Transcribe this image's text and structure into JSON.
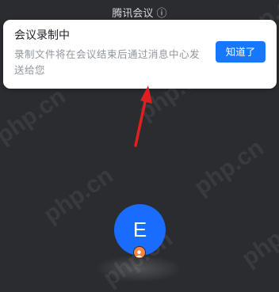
{
  "meeting": {
    "title": "腾讯会议 ⓘ"
  },
  "toast": {
    "title": "会议录制中",
    "message": "录制文件将在会议结束后通过消息中心发送给您",
    "button_label": "知道了"
  },
  "participant": {
    "initial": "E",
    "avatar_color": "#1a6cff",
    "badge_icon": "host-icon"
  },
  "watermark": {
    "text": "php.cn"
  },
  "colors": {
    "background": "#2b2c30",
    "accent": "#1677ff",
    "arrow": "#e02020"
  }
}
